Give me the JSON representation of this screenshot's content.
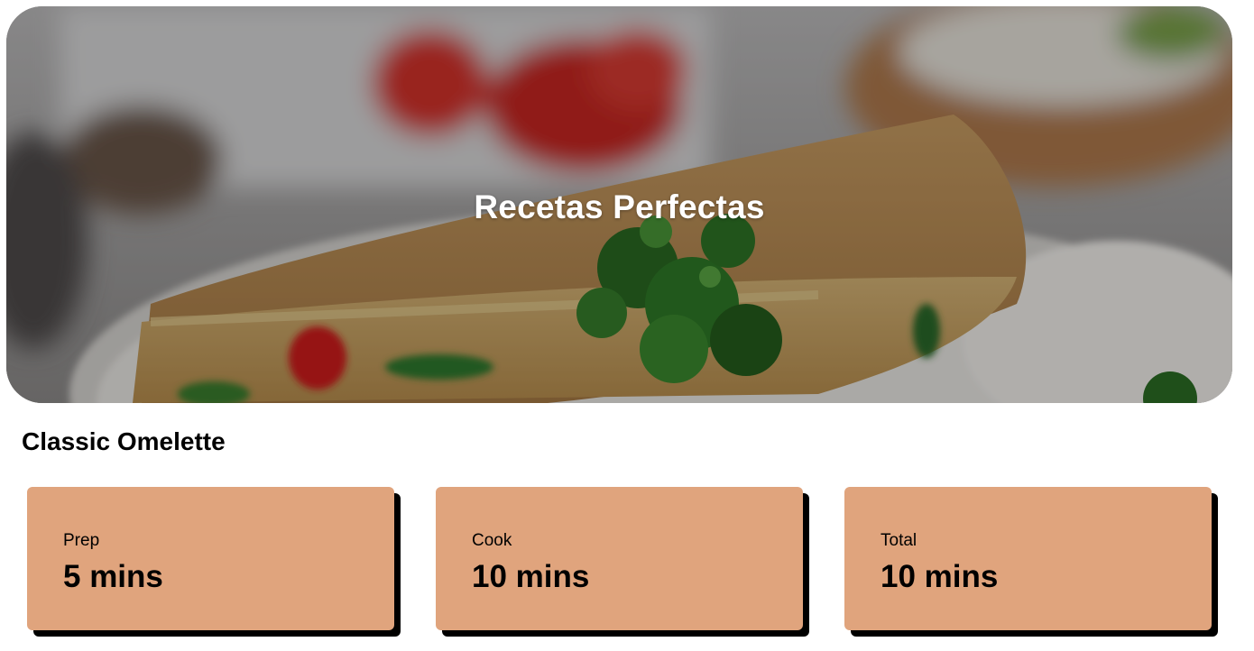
{
  "hero": {
    "title": "Recetas Perfectas"
  },
  "recipe": {
    "title": "Classic Omelette"
  },
  "times": [
    {
      "label": "Prep",
      "value": "5 mins"
    },
    {
      "label": "Cook",
      "value": "10 mins"
    },
    {
      "label": "Total",
      "value": "10 mins"
    }
  ],
  "colors": {
    "card_background": "#e0a47d",
    "card_shadow": "#000000",
    "hero_overlay": "#000000"
  }
}
